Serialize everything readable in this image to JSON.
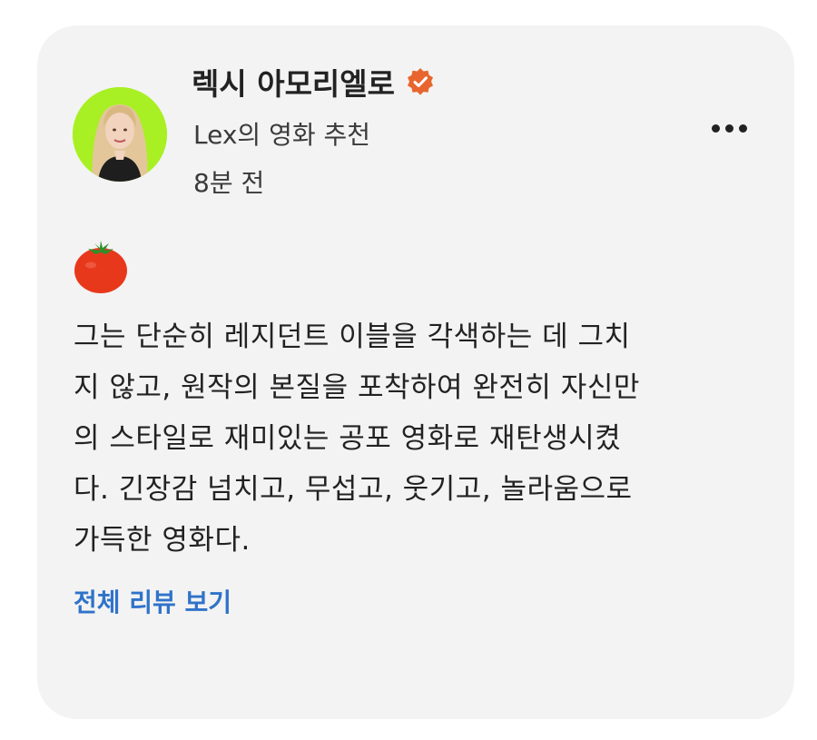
{
  "post": {
    "author_name": "렉시 아모리엘로",
    "source": "Lex의 영화 추천",
    "time_ago": "8분 전",
    "rating_icon": "tomato-icon",
    "review_lines": [
      "그는 단순히 레지던트 이블을 각색하는 데 그치",
      "지 않고, 원작의 본질을 포착하여 완전히 자신만",
      "의 스타일로 재미있는 공포 영화로 재탄생시켰",
      "다. 긴장감 넘치고, 무섭고, 웃기고, 놀라움으로",
      "가득한 영화다."
    ],
    "full_review_link": "전체 리뷰 보기"
  },
  "colors": {
    "card_background": "#f3f3f3",
    "link": "#2f73c9",
    "verified_badge": "#e8662e",
    "avatar_background": "#a8f024",
    "tomato": "#e8381c"
  }
}
